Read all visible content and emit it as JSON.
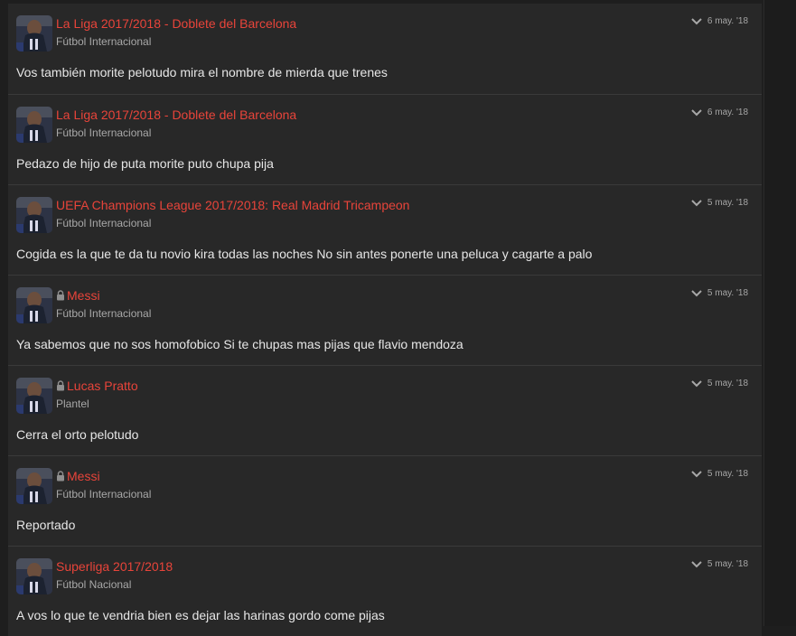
{
  "posts": [
    {
      "title": "La Liga 2017/2018 - Doblete del Barcelona",
      "locked": false,
      "category": "Fútbol Internacional",
      "date": "6 may. '18",
      "text": "Vos también morite pelotudo mira el nombre de mierda que trenes"
    },
    {
      "title": "La Liga 2017/2018 - Doblete del Barcelona",
      "locked": false,
      "category": "Fútbol Internacional",
      "date": "6 may. '18",
      "text": "Pedazo de hijo de puta morite puto chupa pija"
    },
    {
      "title": "UEFA Champions League 2017/2018: Real Madrid Tricampeon",
      "locked": false,
      "category": "Fútbol Internacional",
      "date": "5 may. '18",
      "text": "Cogida es la que te da tu novio kira todas las noches No sin antes ponerte una peluca y cagarte a palo"
    },
    {
      "title": "Messi",
      "locked": true,
      "category": "Fútbol Internacional",
      "date": "5 may. '18",
      "text": "Ya sabemos que no sos homofobico Si te chupas mas pijas que flavio mendoza"
    },
    {
      "title": "Lucas Pratto",
      "locked": true,
      "category": "Plantel",
      "date": "5 may. '18",
      "text": "Cerra el orto pelotudo"
    },
    {
      "title": "Messi",
      "locked": true,
      "category": "Fútbol Internacional",
      "date": "5 may. '18",
      "text": "Reportado"
    },
    {
      "title": "Superliga 2017/2018",
      "locked": false,
      "category": "Fútbol Nacional",
      "date": "5 may. '18",
      "text": "A vos lo que te vendria bien es dejar las harinas gordo come pijas"
    }
  ],
  "icons": {
    "lock": "lock-icon",
    "expand": "chevron-down-icon",
    "avatar": "user-avatar"
  },
  "colors": {
    "title": "#e8443a",
    "background": "#282828",
    "text": "#e6e6e6",
    "muted": "#a8a8a8"
  }
}
